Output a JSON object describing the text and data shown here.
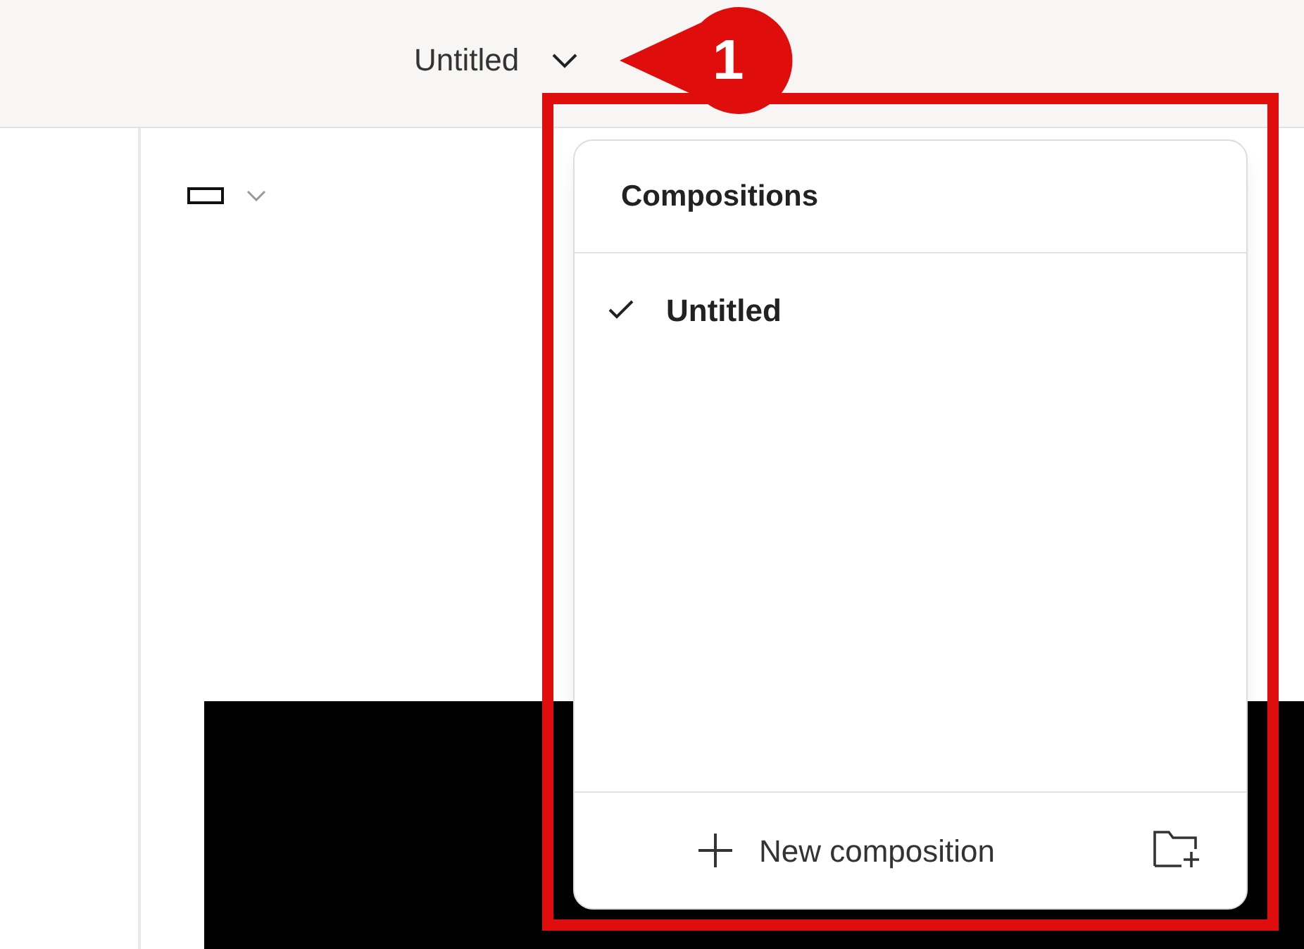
{
  "top_bar": {
    "title": "Untitled"
  },
  "annotation": {
    "number": "1"
  },
  "compositions_menu": {
    "title": "Compositions",
    "items": [
      {
        "label": "Untitled",
        "selected": true
      }
    ],
    "new_button": "New composition"
  }
}
